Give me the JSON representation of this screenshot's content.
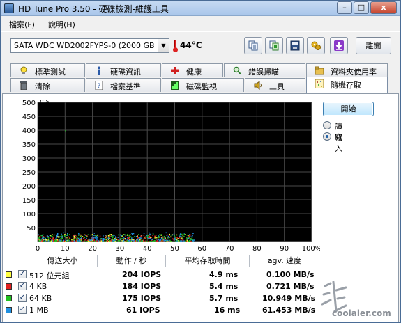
{
  "window": {
    "title": "HD Tune Pro 3.50 - 硬碟檢測-維護工具"
  },
  "titlebar_buttons": {
    "minimize": "–",
    "maximize": "□",
    "close": "x"
  },
  "menu": [
    {
      "label": "檔案(F)"
    },
    {
      "label": "說明(H)"
    }
  ],
  "toolbar": {
    "drive": "SATA   WDC WD2002FYPS-0 (2000 GB",
    "temperature": "44°C",
    "exit_label": "離開",
    "buttons": [
      "copy-text-icon",
      "copy-screenshot-icon",
      "save-icon",
      "options-icon",
      "download-icon"
    ]
  },
  "tabs": {
    "row1": [
      {
        "label": "標準測試",
        "icon": "lightbulb-icon"
      },
      {
        "label": "硬碟資訊",
        "icon": "info-icon"
      },
      {
        "label": "健康",
        "icon": "health-cross-icon"
      },
      {
        "label": "錯誤掃瞄",
        "icon": "magnifier-icon"
      },
      {
        "label": "資料夾使用率",
        "icon": "folder-icon"
      }
    ],
    "row2": [
      {
        "label": "清除",
        "icon": "trash-icon"
      },
      {
        "label": "檔案基準",
        "icon": "file-question-icon"
      },
      {
        "label": "磁碟監視",
        "icon": "monitor-chart-icon"
      },
      {
        "label": "工具",
        "icon": "speaker-icon"
      },
      {
        "label": "隨機存取",
        "icon": "random-access-icon"
      }
    ],
    "active": "隨機存取"
  },
  "controls": {
    "start_label": "開始",
    "options": [
      {
        "label": "讀取",
        "selected": false
      },
      {
        "label": "寫入",
        "selected": true
      }
    ]
  },
  "chart_data": {
    "type": "scatter",
    "ylabel": "ms",
    "ylim": [
      0,
      500
    ],
    "xlim": [
      0,
      100
    ],
    "x_unit": "%",
    "yticks": [
      "500",
      "450",
      "400",
      "350",
      "300",
      "250",
      "200",
      "150",
      "100",
      "50"
    ],
    "xticks": [
      "0",
      "10",
      "20",
      "30",
      "40",
      "50",
      "60",
      "70",
      "80",
      "90",
      "100%"
    ],
    "background": "#000000",
    "grid": true,
    "series": [
      {
        "name": "512 位元組",
        "color": "#ffff40",
        "x_range": [
          0,
          57
        ],
        "y_range": [
          2,
          28
        ]
      },
      {
        "name": "4 KB",
        "color": "#e02020",
        "x_range": [
          0,
          57
        ],
        "y_range": [
          2,
          26
        ]
      },
      {
        "name": "64 KB",
        "color": "#20c020",
        "x_range": [
          0,
          57
        ],
        "y_range": [
          2,
          30
        ]
      },
      {
        "name": "1 MB",
        "color": "#2090e0",
        "x_range": [
          0,
          57
        ],
        "y_range": [
          4,
          34
        ]
      }
    ]
  },
  "results": {
    "headers": [
      "傳送大小",
      "動作 / 秒",
      "平均存取時間",
      "agv. 速度"
    ],
    "rows": [
      {
        "size": "512 位元組",
        "color": "#ffff40",
        "checked": "✓",
        "iops": "204 IOPS",
        "access": "4.9 ms",
        "speed": "0.100 MB/s"
      },
      {
        "size": "4 KB",
        "color": "#e02020",
        "checked": "✓",
        "iops": "184 IOPS",
        "access": "5.4 ms",
        "speed": "0.721 MB/s"
      },
      {
        "size": "64 KB",
        "color": "#20c020",
        "checked": "✓",
        "iops": "175 IOPS",
        "access": "5.7 ms",
        "speed": "10.949 MB/s"
      },
      {
        "size": "1 MB",
        "color": "#2090e0",
        "checked": "✓",
        "iops": "61 IOPS",
        "access": "16 ms",
        "speed": "61.453 MB/s"
      }
    ]
  },
  "watermark": {
    "text": "coolaler.com"
  }
}
